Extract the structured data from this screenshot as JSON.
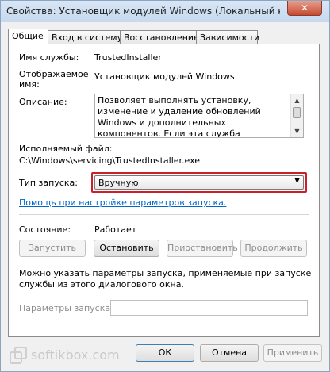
{
  "window": {
    "title": "Свойства: Установщик модулей Windows (Локальный компьют..."
  },
  "tabs": [
    {
      "label": "Общие"
    },
    {
      "label": "Вход в систему"
    },
    {
      "label": "Восстановление"
    },
    {
      "label": "Зависимости"
    }
  ],
  "service": {
    "name_label": "Имя службы:",
    "name_value": "TrustedInstaller",
    "display_label_1": "Отображаемое",
    "display_label_2": "имя:",
    "display_value": "Установщик модулей Windows",
    "desc_label": "Описание:",
    "desc_text": "Позволяет выполнять установку, изменение и удаление обновлений Windows и дополнительных компонентов. Если эта служба отключена, установка или удаление обновлений",
    "exe_label": "Исполняемый файл:",
    "exe_value": "C:\\Windows\\servicing\\TrustedInstaller.exe",
    "startup_label": "Тип запуска:",
    "startup_value": "Вручную",
    "help_link": "Помощь при настройке параметров запуска.",
    "status_label": "Состояние:",
    "status_value": "Работает"
  },
  "buttons": {
    "start": "Запустить",
    "stop": "Остановить",
    "pause": "Приостановить",
    "resume": "Продолжить",
    "ok": "ОК",
    "cancel": "Отмена",
    "apply": "Применить"
  },
  "params": {
    "hint_1": "Можно указать параметры запуска, применяемые при запуске",
    "hint_2": "службы из этого диалогового окна.",
    "label": "Параметры запуска:",
    "value": ""
  },
  "watermark": {
    "text": "softikbox.com"
  }
}
